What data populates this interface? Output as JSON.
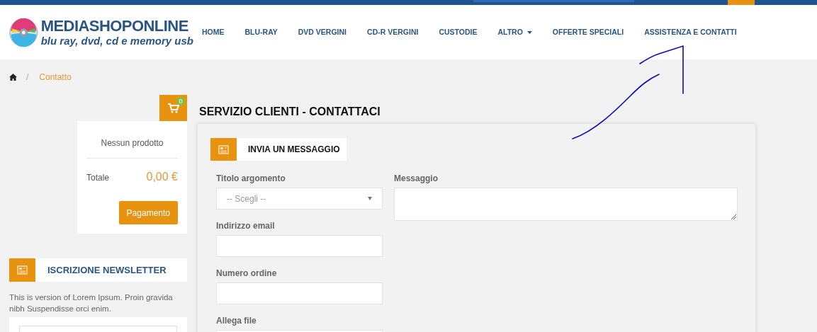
{
  "header": {
    "logo_title": "MEDIASHOPONLINE",
    "logo_tagline": "blu ray, dvd, cd e memory usb"
  },
  "nav": [
    {
      "label": "HOME",
      "dropdown": false
    },
    {
      "label": "BLU-RAY",
      "dropdown": false
    },
    {
      "label": "DVD VERGINI",
      "dropdown": false
    },
    {
      "label": "CD-R VERGINI",
      "dropdown": false
    },
    {
      "label": "CUSTODIE",
      "dropdown": false
    },
    {
      "label": "ALTRO",
      "dropdown": true
    },
    {
      "label": "OFFERTE SPECIALI",
      "dropdown": false
    },
    {
      "label": "ASSISTENZA E CONTATTI",
      "dropdown": false
    }
  ],
  "breadcrumb": {
    "separator": "/",
    "current": "Contatto"
  },
  "cart": {
    "count": "0",
    "empty_text": "Nessun prodotto",
    "total_label": "Totale",
    "total_value": "0,00 €",
    "checkout_button": "Pagamento"
  },
  "newsletter": {
    "title": "ISCRIZIONE NEWSLETTER",
    "text": "This is version of Lorem Ipsum. Proin gravida nibh Suspendisse orci enim."
  },
  "page_title": "SERVIZIO CLIENTI - CONTATTACI",
  "form": {
    "title": "INVIA UN MESSAGGIO",
    "fields": [
      {
        "kind": "select",
        "label": "Titolo argomento",
        "value": "-- Scegli --"
      },
      {
        "kind": "text",
        "label": "Indirizzo email"
      },
      {
        "kind": "text",
        "label": "Numero ordine"
      },
      {
        "kind": "file",
        "label": "Allega file"
      }
    ],
    "message_label": "Messaggio"
  }
}
